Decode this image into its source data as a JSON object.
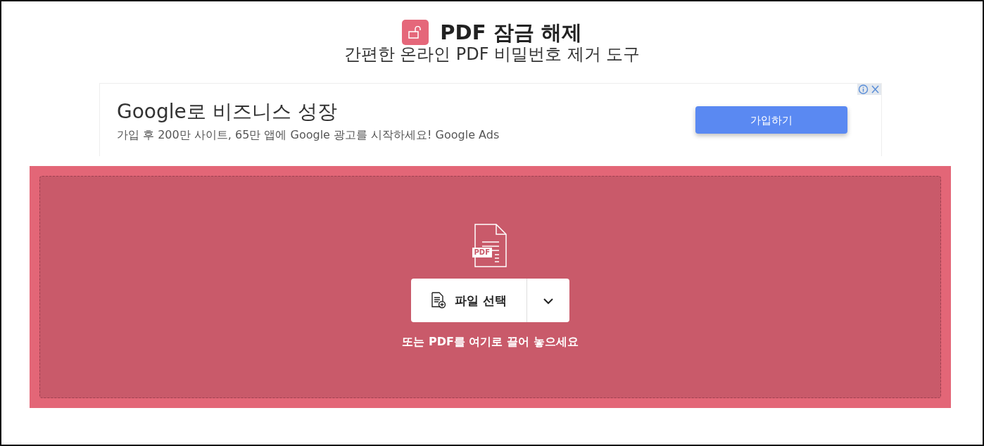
{
  "header": {
    "title": "PDF 잠금 해제",
    "subtitle": "간편한 온라인 PDF 비밀번호 제거 도구"
  },
  "ad": {
    "headline": "Google로 비즈니스 성장",
    "text": "가입 후 200만 사이트, 65만 앱에 Google 광고를 시작하세요! Google Ads",
    "button": "가입하기"
  },
  "dropzone": {
    "file_icon_label": "PDF",
    "choose_button": "파일 선택",
    "hint": "또는 PDF를 여기로 끌어 놓으세요"
  }
}
